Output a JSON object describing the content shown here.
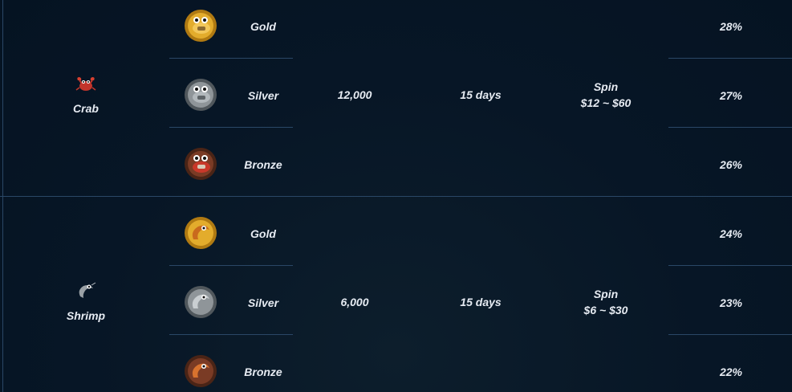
{
  "groups": [
    {
      "animal": "Crab",
      "animal_icon": "crab-icon",
      "value": "12,000",
      "duration": "15 days",
      "reward_title": "Spin",
      "reward_range": "$12 ~ $60",
      "tiers": [
        {
          "tier": "Gold",
          "percent": "28%",
          "medal": "gold-crab-medal-icon",
          "color": "#d8a126"
        },
        {
          "tier": "Silver",
          "percent": "27%",
          "medal": "silver-crab-medal-icon",
          "color": "#8f9599"
        },
        {
          "tier": "Bronze",
          "percent": "26%",
          "medal": "bronze-crab-medal-icon",
          "color": "#7a3b25"
        }
      ]
    },
    {
      "animal": "Shrimp",
      "animal_icon": "shrimp-icon",
      "value": "6,000",
      "duration": "15 days",
      "reward_title": "Spin",
      "reward_range": "$6 ~ $30",
      "tiers": [
        {
          "tier": "Gold",
          "percent": "24%",
          "medal": "gold-shrimp-medal-icon",
          "color": "#d8a126"
        },
        {
          "tier": "Silver",
          "percent": "23%",
          "medal": "silver-shrimp-medal-icon",
          "color": "#8f9599"
        },
        {
          "tier": "Bronze",
          "percent": "22%",
          "medal": "bronze-shrimp-medal-icon",
          "color": "#7a3b25"
        }
      ]
    }
  ],
  "colors": {
    "background": "#061424",
    "divider": "#2a4766",
    "text": "#e6ebf2"
  }
}
